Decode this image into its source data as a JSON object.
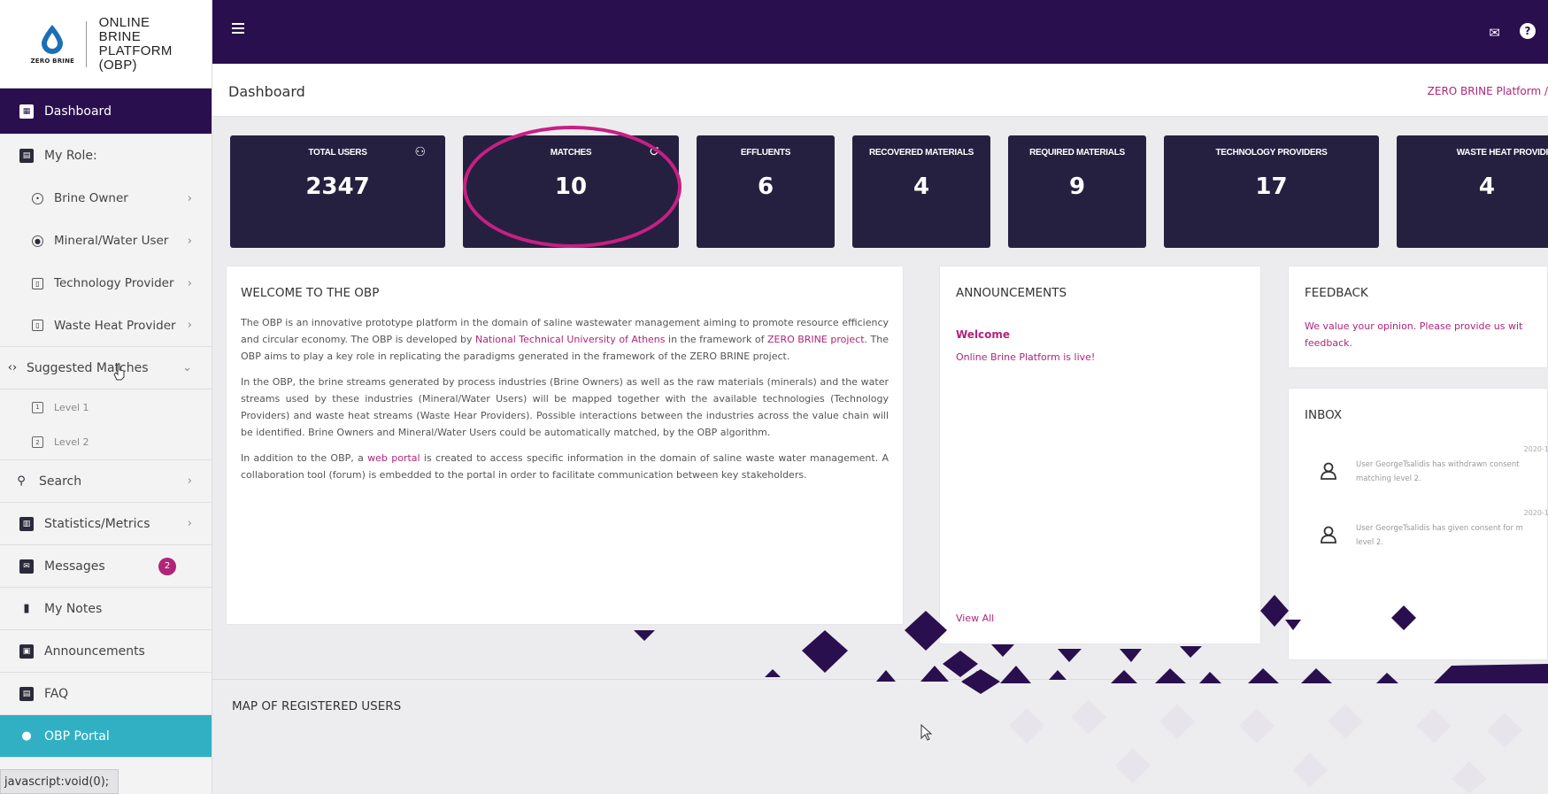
{
  "logo": {
    "brand": "ZERO BRINE",
    "line1": "ONLINE",
    "line2": "BRINE",
    "line3": "PLATFORM (OBP)"
  },
  "sidebar": {
    "dashboard": "Dashboard",
    "my_role": "My Role:",
    "brine_owner": "Brine Owner",
    "mineral_water_user": "Mineral/Water User",
    "technology_provider": "Technology Provider",
    "waste_heat_provider": "Waste Heat Provider",
    "suggested_matches": "Suggested Matches",
    "level1": "Level 1",
    "level2": "Level 2",
    "search": "Search",
    "statistics": "Statistics/Metrics",
    "messages": "Messages",
    "messages_badge": "2",
    "my_notes": "My Notes",
    "announcements": "Announcements",
    "faq": "FAQ",
    "obp_portal": "OBP Portal"
  },
  "status_url": "javascript:void(0);",
  "header": {
    "title": "Dashboard",
    "breadcrumb": "ZERO BRINE Platform /"
  },
  "stats": {
    "total_users": {
      "label": "TOTAL USERS",
      "value": "2347"
    },
    "matches": {
      "label": "MATCHES",
      "value": "10"
    },
    "effluents": {
      "label": "EFFLUENTS",
      "value": "6"
    },
    "recovered_materials": {
      "label": "RECOVERED MATERIALS",
      "value": "4"
    },
    "required_materials": {
      "label": "REQUIRED MATERIALS",
      "value": "9"
    },
    "technology_providers": {
      "label": "TECHNOLOGY PROVIDERS",
      "value": "17"
    },
    "waste_heat_providers": {
      "label": "WASTE HEAT PROVIDI",
      "value": "4"
    }
  },
  "welcome": {
    "title": "WELCOME TO THE OBP",
    "p1a": "The OBP is an innovative prototype platform in the domain of saline wastewater management aiming to promote resource efficiency and circular economy. The OBP is developed by ",
    "p1_link1": "National Technical University of Athens",
    "p1b": " in the framework of ",
    "p1_link2": "ZERO BRINE project",
    "p1c": ". The OBP aims to play a key role in replicating the paradigms generated in the framework of the ZERO BRINE project.",
    "p2": "In the OBP, the brine streams generated by process industries (Brine Owners) as well as the raw materials (minerals) and the water streams used by these industries (Mineral/Water Users) will be mapped together with the available technologies (Technology Providers) and waste heat streams (Waste Hear Providers). Possible interactions between the industries across the value chain will be identified. Brine Owners and Mineral/Water Users could be automatically matched, by the OBP algorithm.",
    "p3a": "In addition to the OBP, a ",
    "p3_link": "web portal",
    "p3b": " is created to access specific information in the domain of saline waste water management. A collaboration tool (forum) is embedded to the portal in order to facilitate communication between key stakeholders."
  },
  "announcements": {
    "title": "ANNOUNCEMENTS",
    "item_title": "Welcome",
    "item_text": "Online Brine Platform is live!",
    "view_all": "View All"
  },
  "feedback": {
    "title": "FEEDBACK",
    "line1": "We value your opinion. Please provide us wit",
    "line2": "feedback."
  },
  "inbox": {
    "title": "INBOX",
    "messages": [
      {
        "date": "2020-1",
        "line1": "User GeorgeTsalidis has withdrawn consent",
        "line2": "matching level 2."
      },
      {
        "date": "2020-1",
        "line1": "User GeorgeTsalidis has given consent for m",
        "line2": "level 2."
      }
    ]
  },
  "map": {
    "title": "MAP OF REGISTERED USERS"
  },
  "colors": {
    "topbar": "#2a0f4f",
    "card": "#262040",
    "accent": "#b0257a",
    "portal": "#31b0c4",
    "highlight": "#c81f83"
  },
  "icons": [
    "hamburger-icon",
    "mail-icon",
    "help-icon",
    "users-icon",
    "matches-icon",
    "person-icon"
  ]
}
